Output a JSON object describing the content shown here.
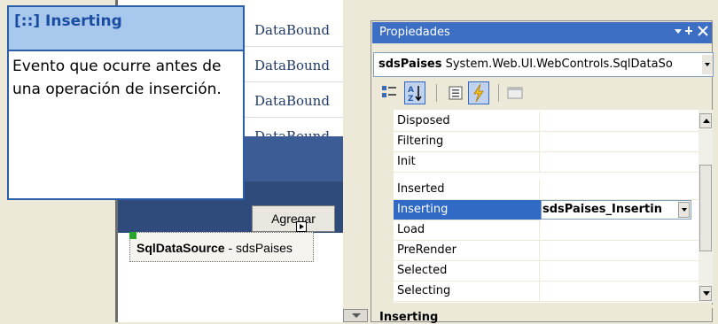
{
  "designer": {
    "grid_rows": [
      "DataBound",
      "DataBound",
      "DataBound",
      "DataBound"
    ],
    "add_button_label": "Agregar",
    "datasource": {
      "type_label": "SqlDataSource",
      "separator": " - ",
      "id": "sdsPaises"
    }
  },
  "tooltip": {
    "title": "[::] Inserting",
    "body": "Evento que ocurre antes de una operación de inserción."
  },
  "properties": {
    "title": "Propiedades",
    "window_controls": "▾ ⊣ ✕",
    "object_name": "sdsPaises",
    "object_type": " System.Web.UI.WebControls.SqlDataSo",
    "toolbar": [
      "categorized-icon",
      "alphabetical-icon",
      "properties-icon",
      "events-icon",
      "property-pages-icon"
    ],
    "events": [
      {
        "name": "Disposed",
        "value": ""
      },
      {
        "name": "Filtering",
        "value": ""
      },
      {
        "name": "Init",
        "value": ""
      },
      {
        "name": "Inserted",
        "value": ""
      },
      {
        "name": "Inserting",
        "value": "sdsPaises_Insertin"
      },
      {
        "name": "Load",
        "value": ""
      },
      {
        "name": "PreRender",
        "value": ""
      },
      {
        "name": "Selected",
        "value": ""
      },
      {
        "name": "Selecting",
        "value": ""
      }
    ],
    "selected_event": "Inserting",
    "description_title": "Inserting",
    "accent_color": "#316ac5",
    "titlebar_color": "#3c6fc3"
  }
}
